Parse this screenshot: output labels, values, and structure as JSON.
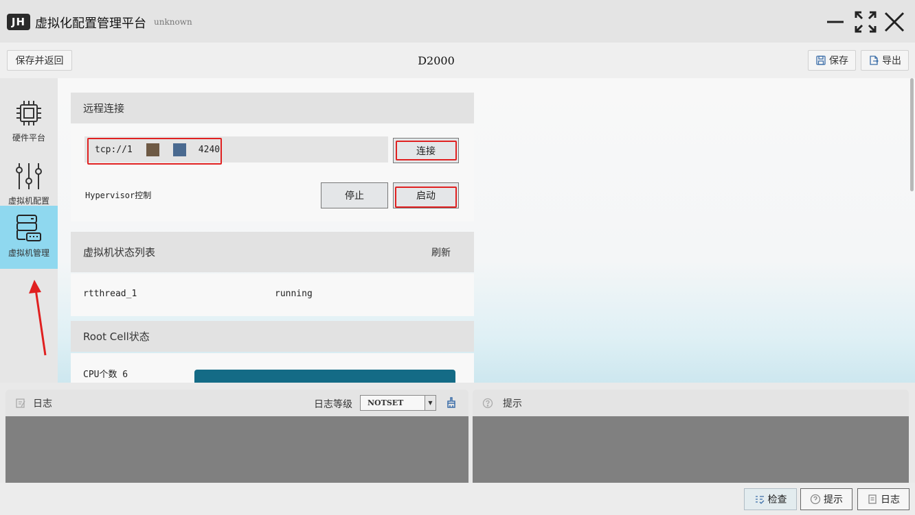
{
  "titlebar": {
    "logo": "JH",
    "title": "虚拟化配置管理平台",
    "subtitle": "unknown"
  },
  "toolbar": {
    "save_return": "保存并返回",
    "device": "D2000",
    "save": "保存",
    "export": "导出"
  },
  "sidebar": {
    "items": [
      {
        "label": "硬件平台",
        "icon": "chip-icon"
      },
      {
        "label": "虚拟机配置",
        "icon": "sliders-icon"
      },
      {
        "label": "虚拟机管理",
        "icon": "server-icon",
        "active": true
      }
    ]
  },
  "remote": {
    "title": "远程连接",
    "address_prefix": "tcp://1",
    "address_suffix": "4240",
    "connect": "连接",
    "hypervisor_label": "Hypervisor控制",
    "stop": "停止",
    "start": "启动"
  },
  "vm_list": {
    "title": "虚拟机状态列表",
    "refresh": "刷新",
    "rows": [
      {
        "name": "rtthread_1",
        "status": "running"
      }
    ]
  },
  "root_cell": {
    "title": "Root Cell状态",
    "cpu_text": "CPU个数 6"
  },
  "log": {
    "title": "日志",
    "level_label": "日志等级",
    "level_value": "NOTSET"
  },
  "hint": {
    "title": "提示"
  },
  "statusbar": {
    "check": "检查",
    "hint": "提示",
    "log": "日志"
  },
  "colors": {
    "accent": "#8fd8ef",
    "highlight": "#e02020",
    "swatch1": "#6e5a45",
    "swatch2": "#4a6a90",
    "bottom_bar": "#146b86"
  }
}
